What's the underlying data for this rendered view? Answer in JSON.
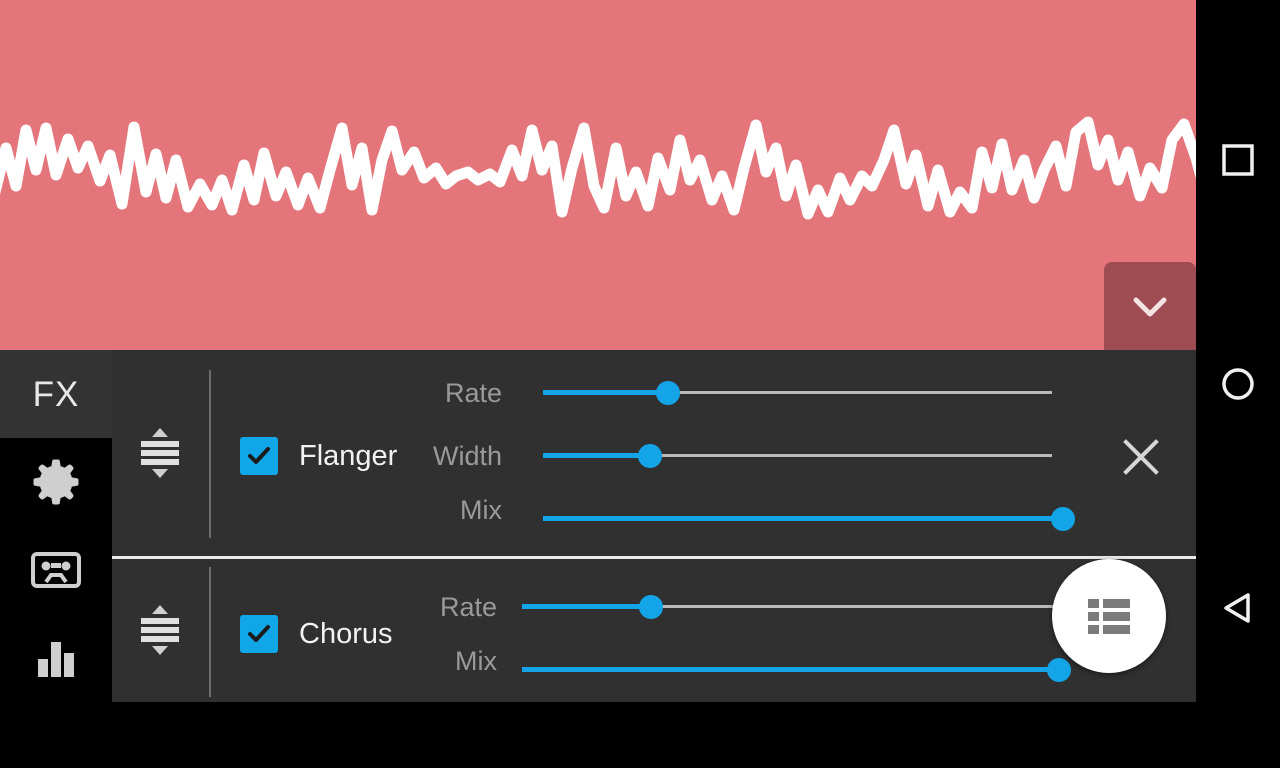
{
  "app": {
    "panel_title": "FX",
    "waveform_color": "#e4757b",
    "waveform_line_color": "#ffffff",
    "accent_color": "#14a4e8",
    "panel_bg": "#303030"
  },
  "header": {
    "collapse_button": {
      "icon": "chevron-down-icon",
      "bg_color": "#9e4c51"
    }
  },
  "rail": {
    "items": [
      {
        "icon": "gear-icon",
        "name": "settings"
      },
      {
        "icon": "cassette-tape-icon",
        "name": "recorder"
      },
      {
        "icon": "bar-chart-icon",
        "name": "levels"
      }
    ]
  },
  "effects": [
    {
      "name": "Flanger",
      "enabled": true,
      "drag_handle_icon": "reorder-handle-icon",
      "close_icon": "close-icon",
      "params": [
        {
          "label": "Rate",
          "value": 24.5
        },
        {
          "label": "Width",
          "value": 21.0
        },
        {
          "label": "Mix",
          "value": 100
        }
      ]
    },
    {
      "name": "Chorus",
      "enabled": true,
      "drag_handle_icon": "reorder-handle-icon",
      "params": [
        {
          "label": "Rate",
          "value": 24.0
        },
        {
          "label": "Mix",
          "value": 98
        }
      ]
    }
  ],
  "fab": {
    "icon": "list-view-icon",
    "bg_color": "#ffffff"
  },
  "navbar": {
    "buttons": [
      {
        "icon": "recents-square-icon",
        "name": "recents"
      },
      {
        "icon": "home-circle-icon",
        "name": "home"
      },
      {
        "icon": "back-triangle-icon",
        "name": "back"
      }
    ]
  }
}
